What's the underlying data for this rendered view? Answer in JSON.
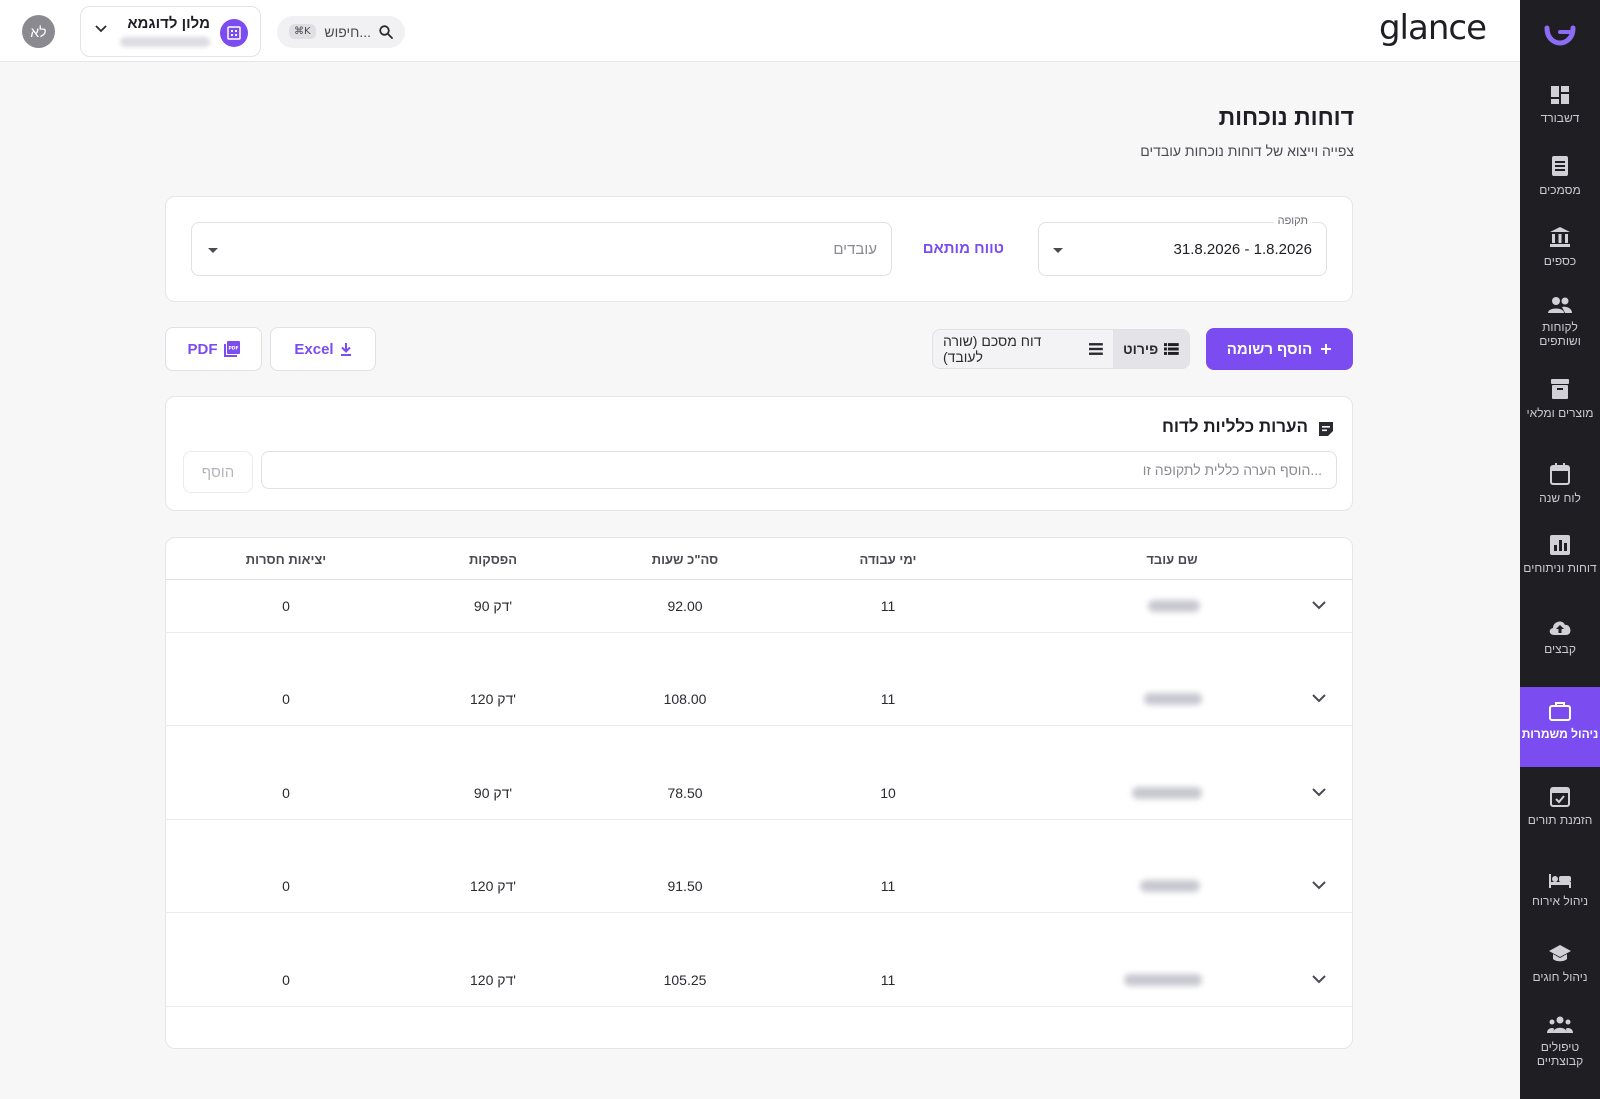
{
  "app": {
    "brand": "glance",
    "colors": {
      "accent": "#7b4cf0",
      "sidebar_bg": "#1f1f23"
    }
  },
  "topbar": {
    "search_placeholder": "חיפוש...",
    "search_shortcut": "⌘K",
    "hotel_name": "מלון לדוגמא",
    "avatar_initials": "לא"
  },
  "sidebar": {
    "items": [
      {
        "label": "דשבורד",
        "icon": "dashboard-icon"
      },
      {
        "label": "מסמכים",
        "icon": "documents-icon"
      },
      {
        "label": "כספים",
        "icon": "bank-icon"
      },
      {
        "label": "לקוחות ושותפים",
        "icon": "people-icon"
      },
      {
        "label": "מוצרים ומלאי",
        "icon": "archive-icon"
      },
      {
        "label": "לוח שנה",
        "icon": "calendar-icon"
      },
      {
        "label": "דוחות וניתוחים",
        "icon": "bar-chart-icon"
      },
      {
        "label": "קבצים",
        "icon": "cloud-upload-icon"
      },
      {
        "label": "ניהול משמרות",
        "icon": "briefcase-icon",
        "active": true
      },
      {
        "label": "הזמנת תורים",
        "icon": "calendar-check-icon"
      },
      {
        "label": "ניהול אירוח",
        "icon": "bed-icon"
      },
      {
        "label": "ניהול חוגים",
        "icon": "graduation-cap-icon"
      },
      {
        "label": "טיפולים קבוצתיים",
        "icon": "group-icon"
      }
    ]
  },
  "page": {
    "title": "דוחות נוכחות",
    "subtitle": "צפייה וייצוא של דוחות נוכחות עובדים"
  },
  "filters": {
    "period_label": "תקופה",
    "period_value": "31.8.2026 - 1.8.2026",
    "custom_range": "טווח מותאם",
    "employees_placeholder": "עובדים"
  },
  "actions": {
    "add_entry": "הוסף רשומה",
    "view_detailed": "פירוט",
    "view_summary": "דוח מסכם (שורה לעובד)",
    "export_excel": "Excel",
    "export_pdf": "PDF"
  },
  "notes": {
    "title": "הערות כלליות לדוח",
    "input_placeholder": "הוסף הערה כללית לתקופה זו...",
    "add_button": "הוסף"
  },
  "table": {
    "headers": {
      "employee": "שם עובד",
      "work_days": "ימי עבודה",
      "total_hours": "סה\"כ שעות",
      "breaks": "הפסקות",
      "absences": "יציאות חסרות"
    },
    "rows": [
      {
        "work_days": "11",
        "total_hours": "92.00",
        "breaks": "90 דק'",
        "absences": "0"
      },
      {
        "work_days": "11",
        "total_hours": "108.00",
        "breaks": "120 דק'",
        "absences": "0"
      },
      {
        "work_days": "10",
        "total_hours": "78.50",
        "breaks": "90 דק'",
        "absences": "0"
      },
      {
        "work_days": "11",
        "total_hours": "91.50",
        "breaks": "120 דק'",
        "absences": "0"
      },
      {
        "work_days": "11",
        "total_hours": "105.25",
        "breaks": "120 דק'",
        "absences": "0"
      }
    ]
  }
}
